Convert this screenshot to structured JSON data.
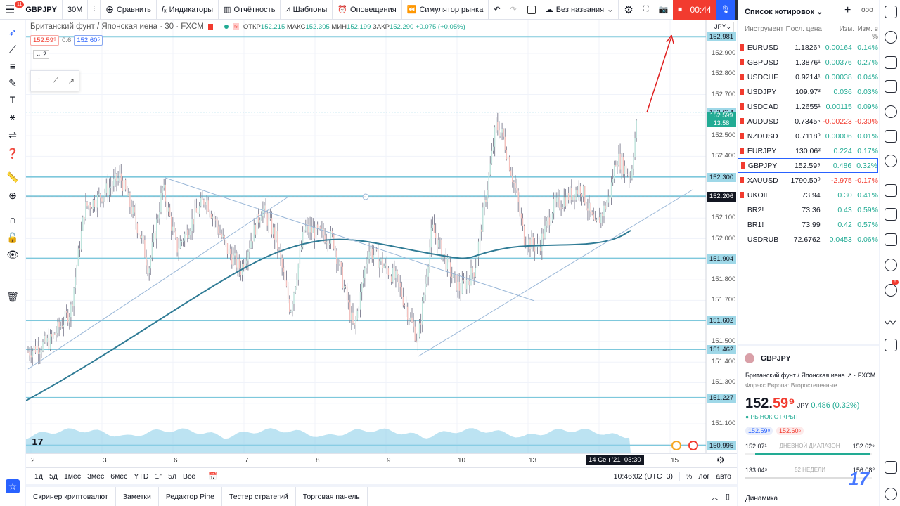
{
  "topbar": {
    "notif_count": "11",
    "symbol": "GBPJPY",
    "interval": "30M",
    "compare": "Сравнить",
    "indicators": "Индикаторы",
    "reports": "Отчётность",
    "templates": "Шаблоны",
    "alerts": "Оповещения",
    "replay": "Симулятор рынка",
    "layout_name": "Без названия",
    "rec_time": "00:44"
  },
  "legend": {
    "title": "Британский фунт / Японская иена · 30 · FXCM",
    "o_label": "ОТКР",
    "o": "152.215",
    "h_label": "МАКС",
    "h": "152.305",
    "l_label": "МИН",
    "l": "152.199",
    "c_label": "ЗАКР",
    "c": "152.290",
    "change": "+0.075 (+0.05%)",
    "sell": "152.59⁹",
    "spread": "0.6",
    "buy": "152.60⁵",
    "collapse_count": "2"
  },
  "price_axis": {
    "currency": "JPY",
    "ticks": [
      "152.900",
      "152.800",
      "152.700",
      "152.500",
      "152.400",
      "152.100",
      "152.000",
      "151.800",
      "151.700",
      "151.500",
      "151.400",
      "151.300",
      "151.100"
    ],
    "levels": [
      {
        "label": "152.981",
        "v": 152.981
      },
      {
        "label": "152.614",
        "v": 152.614
      },
      {
        "label": "152.300",
        "v": 152.3
      },
      {
        "label": "152.206",
        "v": 152.206
      },
      {
        "label": "151.904",
        "v": 151.904
      },
      {
        "label": "151.602",
        "v": 151.602
      },
      {
        "label": "151.462",
        "v": 151.462
      },
      {
        "label": "151.227",
        "v": 151.227
      },
      {
        "label": "150.995",
        "v": 150.995
      }
    ],
    "current": "152.599",
    "countdown": "13:58",
    "crosshair": "152.206"
  },
  "price_path": [
    [
      0,
      151.45
    ],
    [
      3,
      151.5
    ],
    [
      6,
      151.65
    ],
    [
      8,
      152.15
    ],
    [
      10,
      152.2
    ],
    [
      13,
      152.3
    ],
    [
      16,
      152.0
    ],
    [
      17,
      151.85
    ],
    [
      19,
      152.25
    ],
    [
      21,
      151.95
    ],
    [
      25,
      152.2
    ],
    [
      28,
      151.95
    ],
    [
      30,
      151.85
    ],
    [
      33,
      152.15
    ],
    [
      35,
      152.0
    ],
    [
      37,
      151.65
    ],
    [
      39,
      152.05
    ],
    [
      43,
      152.0
    ],
    [
      46,
      151.55
    ],
    [
      48,
      151.95
    ],
    [
      52,
      151.8
    ],
    [
      55,
      151.5
    ],
    [
      57,
      152.05
    ],
    [
      60,
      151.8
    ],
    [
      61,
      151.75
    ],
    [
      63,
      151.85
    ],
    [
      65,
      152.3
    ],
    [
      66,
      152.55
    ],
    [
      67,
      152.5
    ],
    [
      69,
      152.2
    ],
    [
      70,
      152.0
    ],
    [
      72,
      151.95
    ],
    [
      74,
      152.15
    ],
    [
      76,
      152.2
    ],
    [
      78,
      152.25
    ],
    [
      80,
      152.05
    ],
    [
      82,
      152.2
    ],
    [
      83,
      152.4
    ],
    [
      85,
      152.3
    ],
    [
      86,
      152.6
    ]
  ],
  "time_axis": {
    "labels": [
      "2",
      "3",
      "6",
      "7",
      "8",
      "9",
      "10",
      "13",
      "15"
    ],
    "crosshair": "14 Сен '21  03:30"
  },
  "rangebar": {
    "ranges": [
      "1д",
      "5д",
      "1мес",
      "3мес",
      "6мес",
      "YTD",
      "1г",
      "5л",
      "Все"
    ],
    "clock": "10:46:02 (UTC+3)",
    "pct": "%",
    "log": "лог",
    "auto": "авто"
  },
  "bottom_tabs": [
    "Скринер криптовалют",
    "Заметки",
    "Редактор Pine",
    "Тестер стратегий",
    "Торговая панель"
  ],
  "watchlist": {
    "title": "Список котировок",
    "col_sym": "Инструмент",
    "col_last": "Посл. цена",
    "col_chg": "Изм.",
    "col_pct": "Изм. в %",
    "rows": [
      {
        "sym": "EURUSD",
        "last": "1.1826⁶",
        "chg": "0.00164",
        "pct": "0.14%",
        "flag": true,
        "neg": false
      },
      {
        "sym": "GBPUSD",
        "last": "1.3876¹",
        "chg": "0.00376",
        "pct": "0.27%",
        "flag": true,
        "neg": false
      },
      {
        "sym": "USDCHF",
        "last": "0.9214¹",
        "chg": "0.00038",
        "pct": "0.04%",
        "flag": true,
        "neg": false
      },
      {
        "sym": "USDJPY",
        "last": "109.97³",
        "chg": "0.036",
        "pct": "0.03%",
        "flag": true,
        "neg": false
      },
      {
        "sym": "USDCAD",
        "last": "1.2655¹",
        "chg": "0.00115",
        "pct": "0.09%",
        "flag": true,
        "neg": false
      },
      {
        "sym": "AUDUSD",
        "last": "0.7345⁵",
        "chg": "-0.00223",
        "pct": "-0.30%",
        "flag": true,
        "neg": true
      },
      {
        "sym": "NZDUSD",
        "last": "0.7118⁰",
        "chg": "0.00006",
        "pct": "0.01%",
        "flag": true,
        "neg": false
      },
      {
        "sym": "EURJPY",
        "last": "130.06²",
        "chg": "0.224",
        "pct": "0.17%",
        "flag": true,
        "neg": false
      },
      {
        "sym": "GBPJPY",
        "last": "152.59⁹",
        "chg": "0.486",
        "pct": "0.32%",
        "flag": true,
        "neg": false
      },
      {
        "sym": "XAUUSD",
        "last": "1790.50⁰",
        "chg": "-2.975",
        "pct": "-0.17%",
        "flag": true,
        "neg": true
      },
      {
        "sym": "UKOIL",
        "last": "73.94",
        "chg": "0.30",
        "pct": "0.41%",
        "flag": true,
        "neg": false
      },
      {
        "sym": "BR2!",
        "last": "73.36",
        "chg": "0.43",
        "pct": "0.59%",
        "flag": false,
        "neg": false
      },
      {
        "sym": "BR1!",
        "last": "73.99",
        "chg": "0.42",
        "pct": "0.57%",
        "flag": false,
        "neg": false
      },
      {
        "sym": "USDRUB",
        "last": "72.6762",
        "chg": "0.0453",
        "pct": "0.06%",
        "flag": false,
        "neg": false
      }
    ]
  },
  "details": {
    "symbol": "GBPJPY",
    "name": "Британский фунт / Японская иена",
    "exchange": "FXCM",
    "category": "Форекс Европа: Второстепенные",
    "price_main": "152.",
    "price_tail": "59⁹",
    "currency": "JPY",
    "change": "0.486 (0.32%)",
    "market": "РЫНОК ОТКРЫТ",
    "bid": "152.59⁹",
    "ask": "152.60⁵",
    "day_low": "152.07¹",
    "day_label": "ДНЕВНОЙ ДИАПАЗОН",
    "day_high": "152.62⁹",
    "day_progress": 0.99,
    "wk_low": "133.04⁵",
    "wk_label": "52 НЕДЕЛИ",
    "wk_high": "156.08⁰",
    "wk_progress": 0.85,
    "dynamics": "Динамика"
  },
  "right_badge": "6"
}
